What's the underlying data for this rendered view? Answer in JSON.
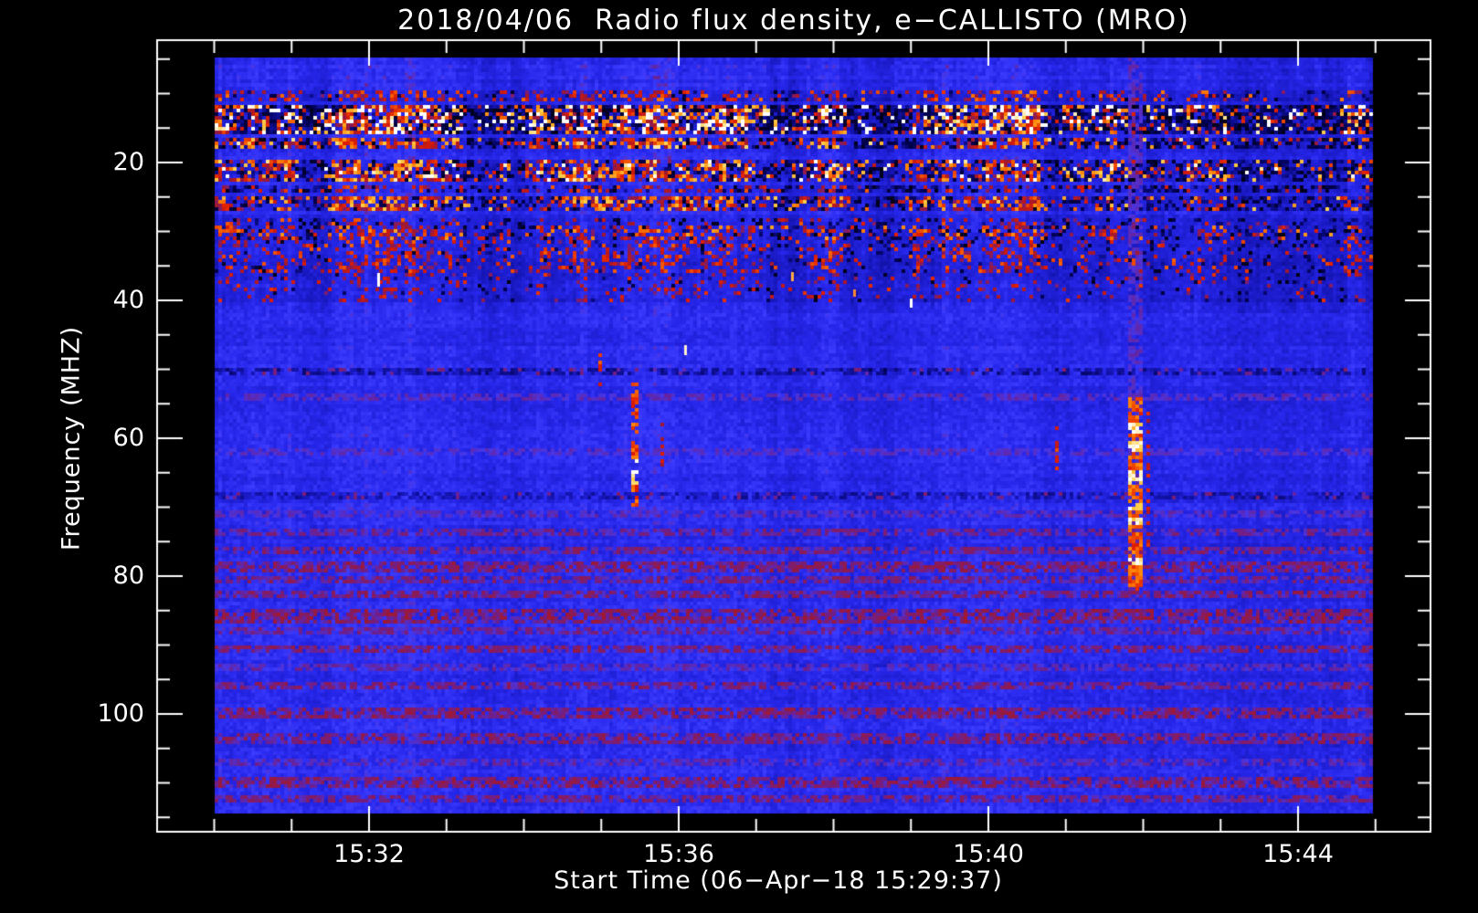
{
  "window": {
    "background": "#000000",
    "text_color": "#ffffff"
  },
  "chart_data": {
    "type": "heatmap",
    "title": "2018/04/06  Radio flux density, e−CALLISTO (MRO)",
    "x_axis": {
      "label": "Start Time (06−Apr−18 15:29:37)",
      "ticks": [
        "15:32",
        "15:36",
        "15:40",
        "15:44"
      ],
      "minor_step_min": 1,
      "minor_first": "15:30",
      "minor_last": "15:45"
    },
    "y_axis": {
      "label": "Frequency (MHZ)",
      "ticks": [
        20,
        40,
        60,
        80,
        100
      ],
      "minor_step": 5,
      "minor_first": 5,
      "minor_last": 115,
      "direction": "down",
      "data_range": [
        5,
        114.5
      ]
    },
    "data_time_range": [
      "15:30:00",
      "15:45:00"
    ],
    "grid": false,
    "legend": "none",
    "palette": {
      "stops": [
        [
          0.0,
          "#000000"
        ],
        [
          0.18,
          "#000050"
        ],
        [
          0.4,
          "#1616b8"
        ],
        [
          0.52,
          "#2626ea"
        ],
        [
          0.6,
          "#3c3cff"
        ],
        [
          0.66,
          "#6d1f8e"
        ],
        [
          0.73,
          "#a01830"
        ],
        [
          0.81,
          "#e01c00"
        ],
        [
          0.89,
          "#ff7c00"
        ],
        [
          0.96,
          "#ffd24d"
        ],
        [
          1.0,
          "#ffffff"
        ]
      ],
      "base_level": 0.53,
      "stripe_amp_top": 0.085,
      "stripe_amp_low": 0.05,
      "cell_noise": 0.09
    },
    "rfi_bands": [
      {
        "f0": 9.7,
        "f1": 11.3,
        "black": 0.1,
        "hot": 0.3,
        "heat": 0.55
      },
      {
        "f0": 11.9,
        "f1": 15.7,
        "black": 0.45,
        "hot": 0.44,
        "heat": 0.95
      },
      {
        "f0": 16.4,
        "f1": 17.9,
        "black": 0.3,
        "hot": 0.38,
        "heat": 0.75
      },
      {
        "f0": 19.5,
        "f1": 22.9,
        "black": 0.28,
        "hot": 0.4,
        "heat": 0.8
      },
      {
        "f0": 23.5,
        "f1": 24.6,
        "black": 0.32,
        "hot": 0.18,
        "heat": 0.5
      },
      {
        "f0": 24.9,
        "f1": 26.9,
        "black": 0.22,
        "hot": 0.38,
        "heat": 0.7
      },
      {
        "f0": 28.0,
        "f1": 29.0,
        "black": 0.15,
        "hot": 0.15,
        "heat": 0.5
      },
      {
        "f0": 29.3,
        "f1": 31.1,
        "black": 0.18,
        "hot": 0.32,
        "heat": 0.62
      },
      {
        "f0": 31.5,
        "f1": 36.0,
        "black": 0.08,
        "hot": 0.22,
        "heat": 0.5
      },
      {
        "f0": 36.0,
        "f1": 40.5,
        "black": 0.04,
        "hot": 0.1,
        "heat": 0.42
      }
    ],
    "rfi_rows": [
      {
        "f": 50.2,
        "df": 0.6,
        "strength": 0.7,
        "mode": "dark"
      },
      {
        "f": 68.2,
        "df": 0.5,
        "strength": 0.55,
        "mode": "dark"
      },
      {
        "f": 54.0,
        "df": 0.4,
        "strength": 0.3,
        "mode": "speckle"
      },
      {
        "f": 62.0,
        "df": 0.4,
        "strength": 0.25,
        "mode": "speckle"
      },
      {
        "f": 71.0,
        "df": 0.4,
        "strength": 0.3,
        "mode": "speckle"
      },
      {
        "f": 73.5,
        "df": 0.5,
        "strength": 0.5,
        "mode": "speckle"
      },
      {
        "f": 76.2,
        "df": 0.5,
        "strength": 0.6,
        "mode": "speckle"
      },
      {
        "f": 78.9,
        "df": 0.8,
        "strength": 0.7,
        "mode": "speckle"
      },
      {
        "f": 80.6,
        "df": 0.5,
        "strength": 0.6,
        "mode": "speckle"
      },
      {
        "f": 82.6,
        "df": 0.6,
        "strength": 0.65,
        "mode": "speckle"
      },
      {
        "f": 85.8,
        "df": 0.9,
        "strength": 0.75,
        "mode": "speckle"
      },
      {
        "f": 88.1,
        "df": 0.5,
        "strength": 0.5,
        "mode": "speckle"
      },
      {
        "f": 90.6,
        "df": 0.7,
        "strength": 0.65,
        "mode": "speckle"
      },
      {
        "f": 93.2,
        "df": 0.4,
        "strength": 0.35,
        "mode": "speckle"
      },
      {
        "f": 96.0,
        "df": 0.6,
        "strength": 0.6,
        "mode": "speckle"
      },
      {
        "f": 99.9,
        "df": 0.8,
        "strength": 0.7,
        "mode": "speckle"
      },
      {
        "f": 103.8,
        "df": 0.8,
        "strength": 0.65,
        "mode": "speckle"
      },
      {
        "f": 107.0,
        "df": 0.4,
        "strength": 0.35,
        "mode": "speckle"
      },
      {
        "f": 109.8,
        "df": 0.9,
        "strength": 0.7,
        "mode": "speckle"
      },
      {
        "f": 112.4,
        "df": 0.7,
        "strength": 0.6,
        "mode": "speckle"
      }
    ],
    "bursts": [
      {
        "time": "15:34:58",
        "f0": 47.0,
        "f1": 52.5,
        "width_s": 2.5,
        "density": 0.5,
        "heat": 0.82,
        "bright": []
      },
      {
        "time": "15:35:27",
        "f0": 52.0,
        "f1": 71.0,
        "width_s": 5.0,
        "density": 0.55,
        "heat": 0.85,
        "bright": [
          [
            63,
            67
          ]
        ]
      },
      {
        "time": "15:35:47",
        "f0": 58.0,
        "f1": 66.0,
        "width_s": 2.5,
        "density": 0.4,
        "heat": 0.76,
        "bright": []
      },
      {
        "time": "15:40:52",
        "f0": 58.0,
        "f1": 65.5,
        "width_s": 2.5,
        "density": 0.5,
        "heat": 0.8,
        "bright": []
      },
      {
        "time": "15:41:20",
        "f0": 45.0,
        "f1": 70.0,
        "width_s": 2.0,
        "density": 0.35,
        "heat": 0.75,
        "bright": []
      },
      {
        "time": "15:41:53",
        "f0": 54.0,
        "f1": 82.0,
        "width_s": 11.0,
        "density": 0.8,
        "heat": 0.86,
        "bright": [
          [
            58,
            59.5
          ],
          [
            60.5,
            62
          ],
          [
            64.5,
            66.5
          ],
          [
            69.5,
            70.5
          ],
          [
            71.5,
            72.5
          ],
          [
            77.5,
            78.5
          ]
        ],
        "shadow_f": [
          5,
          84
        ],
        "shadow_density": 0.55
      },
      {
        "time": "15:42:03",
        "f0": 56.0,
        "f1": 76.0,
        "width_s": 3.0,
        "density": 0.45,
        "heat": 0.78,
        "bright": []
      }
    ],
    "point_bursts": [
      {
        "time": "15:32:07",
        "f0": 36.0,
        "f1": 38.0,
        "color": "#ffffff"
      },
      {
        "time": "15:37:28",
        "f0": 35.9,
        "f1": 37.2,
        "color": "#ffaa44"
      },
      {
        "time": "15:38:16",
        "f0": 38.4,
        "f1": 39.5,
        "color": "#ff8833"
      },
      {
        "time": "15:39:00",
        "f0": 39.7,
        "f1": 41.0,
        "color": "#ffffff"
      },
      {
        "time": "15:36:05",
        "f0": 46.5,
        "f1": 48.0,
        "color": "#ffeecc"
      }
    ]
  }
}
